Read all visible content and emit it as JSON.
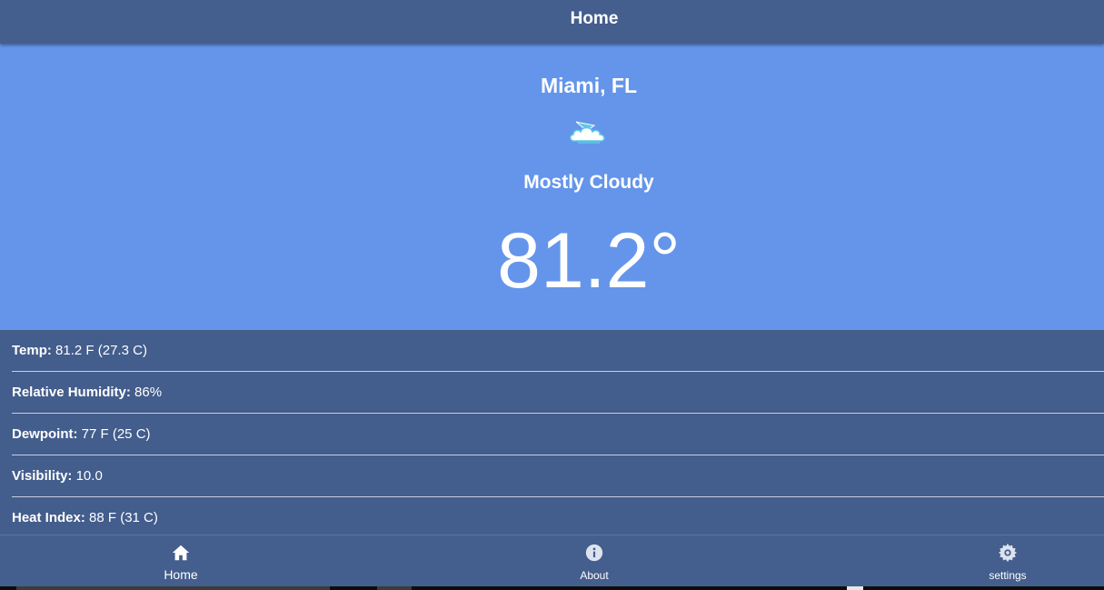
{
  "header": {
    "title": "Home"
  },
  "current": {
    "location": "Miami, FL",
    "condition": "Mostly Cloudy",
    "condition_icon": "mostly-cloudy-icon",
    "temperature": "81.2°"
  },
  "details": [
    {
      "label": "Temp:",
      "value": " 81.2 F (27.3 C)"
    },
    {
      "label": "Relative Humidity:",
      "value": " 86%"
    },
    {
      "label": "Dewpoint:",
      "value": " 77 F (25 C)"
    },
    {
      "label": "Visibility:",
      "value": " 10.0"
    },
    {
      "label": "Heat Index:",
      "value": " 88 F (31 C)"
    }
  ],
  "tabs": [
    {
      "label": "Home",
      "icon": "home-icon",
      "active": true
    },
    {
      "label": "About",
      "icon": "info-icon",
      "active": false
    },
    {
      "label": "settings",
      "icon": "gear-icon",
      "active": false
    }
  ],
  "colors": {
    "header_bg": "#445e8d",
    "hero_bg": "#6495ea",
    "details_bg": "#435d8c",
    "text": "#ffffff"
  }
}
